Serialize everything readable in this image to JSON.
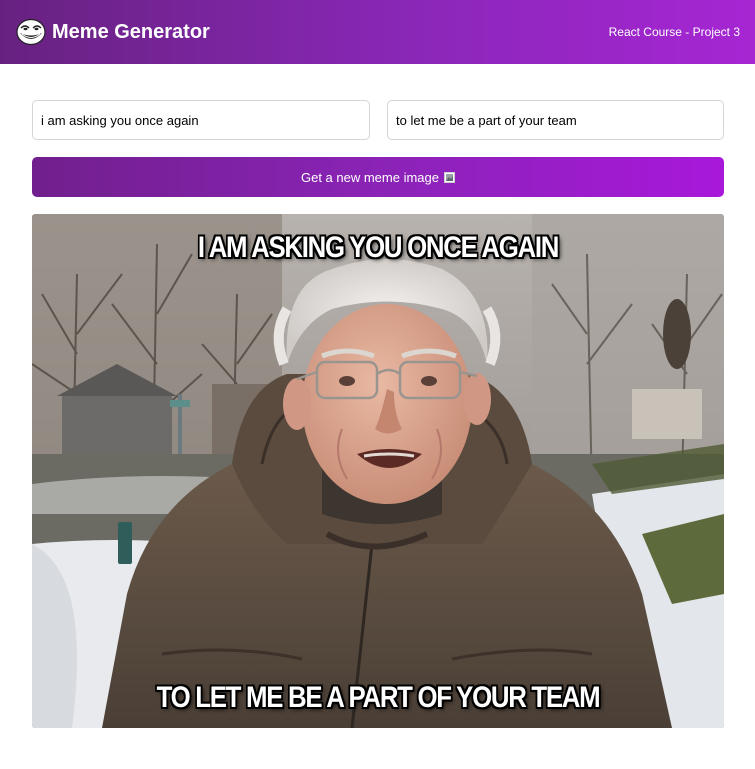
{
  "header": {
    "title": "Meme Generator",
    "course_label": "React Course - Project 3",
    "logo_icon": "troll-face-icon"
  },
  "form": {
    "top_text": "i am asking you once again",
    "bottom_text": "to let me be a part of your team",
    "button_label": "Get a new meme image",
    "button_icon": "picture-frame-icon"
  },
  "meme": {
    "top_caption": "I AM ASKING YOU ONCE AGAIN",
    "bottom_caption": "TO LET ME BE A PART OF YOUR TEAM",
    "image_subject": "older man with white hair and glasses in brown winter parka, snowy park background"
  },
  "colors": {
    "header_start": "#672280",
    "header_end": "#a626d3",
    "button_start": "#711f8d",
    "button_end": "#a818da"
  }
}
